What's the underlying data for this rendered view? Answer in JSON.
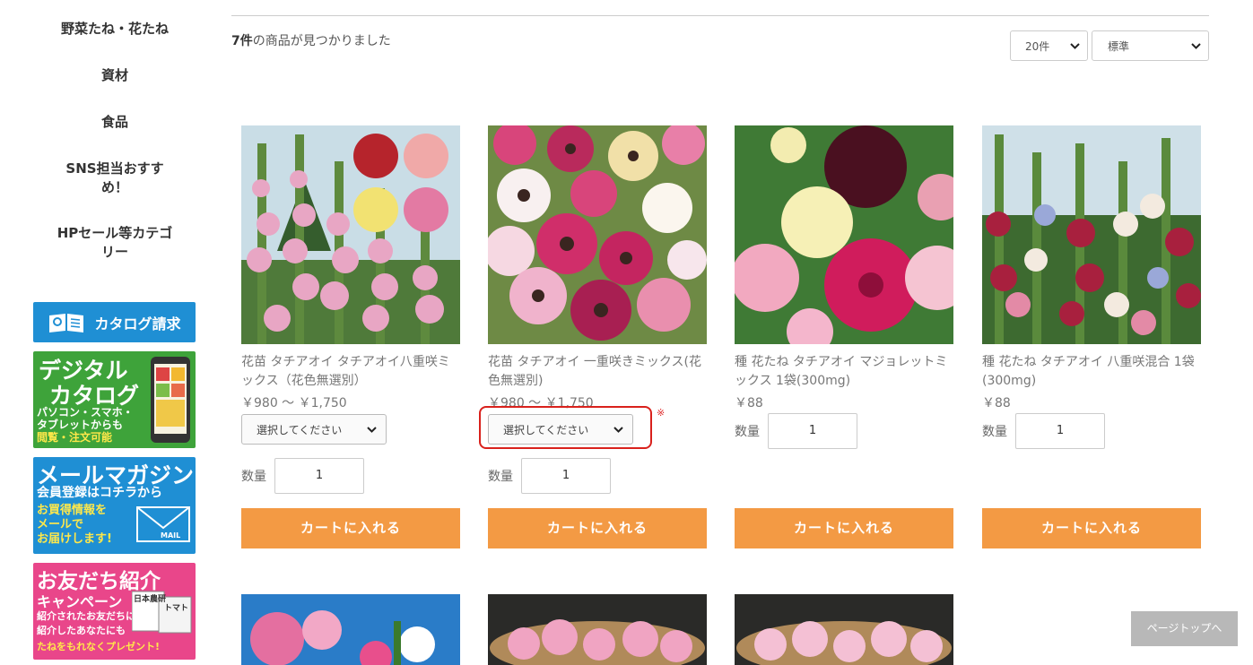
{
  "sidebar": {
    "categories": [
      {
        "label": "野菜たね・花たね"
      },
      {
        "label": "資材"
      },
      {
        "label": "食品"
      },
      {
        "label": "SNS担当おすすめ！"
      },
      {
        "label": "HPセール等カテゴリー"
      }
    ],
    "banners": {
      "catalog": {
        "label": "カタログ請求"
      },
      "digital": {
        "title1": "デジタル",
        "title2": "カタログ",
        "line1": "パソコン・スマホ・",
        "line2": "タブレットからも",
        "line3": "閲覧・注文可能"
      },
      "mail": {
        "title": "メールマガジン",
        "line1": "会員登録はコチラから",
        "line2": "お買得情報を",
        "line3": "メールで",
        "line4": "お届けします!",
        "tag": "MAIL"
      },
      "friend": {
        "title": "お友だち紹介",
        "subtitle": "キャンペーン",
        "line1": "紹介されたお友だちにも",
        "line2": "紹介したあなたにも",
        "line3": "たねをもれなくプレゼント!",
        "tag1": "日本農研",
        "tag2": "トマト"
      }
    }
  },
  "results": {
    "count": "7件",
    "suffix": "の商品が見つかりました"
  },
  "controls": {
    "per_page": "20件",
    "sort": "標準"
  },
  "products": [
    {
      "name": "花苗 タチアオイ タチアオイ八重咲ミックス（花色無選別）",
      "price": "￥980 ～ ￥1,750",
      "select": "選択してください",
      "qty_label": "数量",
      "qty": "1",
      "cart": "カートに入れる"
    },
    {
      "name": "花苗 タチアオイ 一重咲きミックス(花色無選別)",
      "price": "￥980 ～ ￥1,750",
      "select": "選択してください",
      "required_mark": "※",
      "qty_label": "数量",
      "qty": "1",
      "cart": "カートに入れる"
    },
    {
      "name": "種 花たね タチアオイ マジョレットミックス 1袋(300mg)",
      "price": "￥88",
      "qty_label": "数量",
      "qty": "1",
      "cart": "カートに入れる"
    },
    {
      "name": "種 花たね タチアオイ 八重咲混合 1袋(300mg)",
      "price": "￥88",
      "qty_label": "数量",
      "qty": "1",
      "cart": "カートに入れる"
    }
  ],
  "page_top": "ページトップへ",
  "colors": {
    "accent_orange": "#f39a44",
    "highlight_red": "#d9211c",
    "banner_blue": "#1f8fd4",
    "banner_green": "#3ea33a",
    "banner_pink": "#e9468a"
  }
}
